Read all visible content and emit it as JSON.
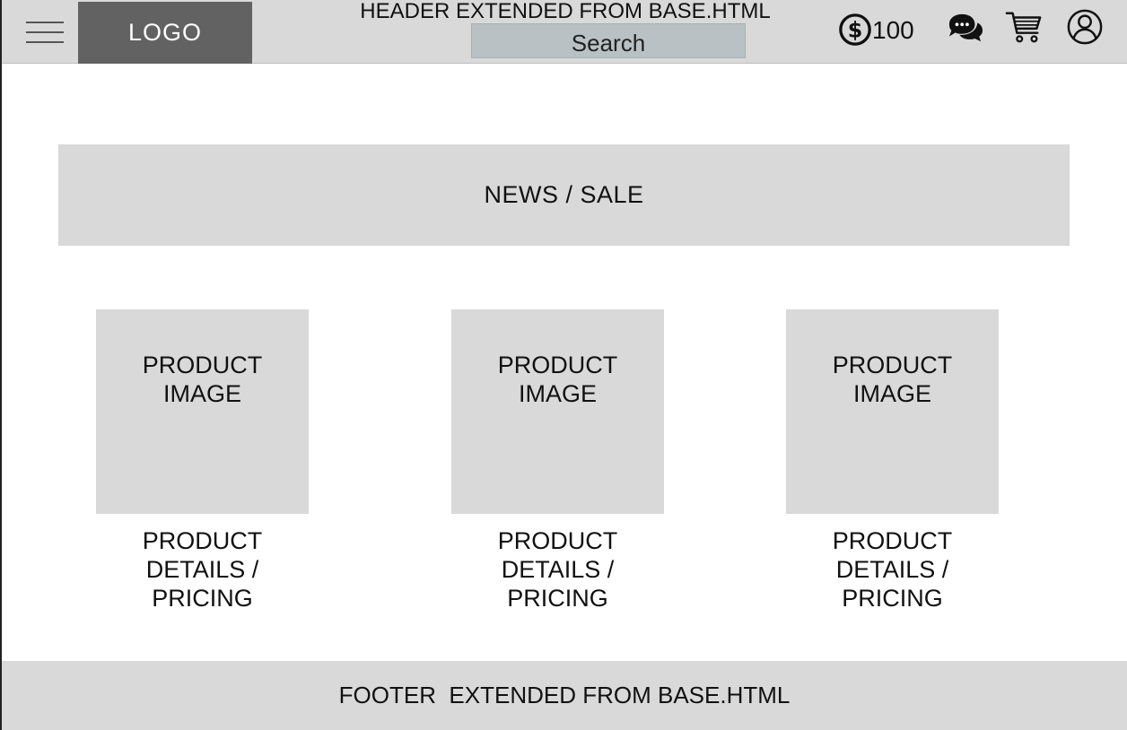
{
  "header": {
    "title": "HEADER EXTENDED FROM BASE.HTML",
    "logo": "LOGO",
    "search_label": "Search",
    "credits": "100",
    "icons": [
      "hamburger-menu-icon",
      "dollar-coin-icon",
      "chat-bubbles-icon",
      "shopping-cart-icon",
      "user-account-icon"
    ]
  },
  "banner": {
    "label": "NEWS / SALE"
  },
  "products": [
    {
      "image_label": "PRODUCT\nIMAGE",
      "details": "PRODUCT\nDETAILS /\nPRICING"
    },
    {
      "image_label": "PRODUCT\nIMAGE",
      "details": "PRODUCT\nDETAILS /\nPRICING"
    },
    {
      "image_label": "PRODUCT\nIMAGE",
      "details": "PRODUCT\nDETAILS /\nPRICING"
    }
  ],
  "footer": {
    "label": "FOOTER  EXTENDED FROM BASE.HTML"
  },
  "colors": {
    "header_bg": "#d9d9d9",
    "logo_bg": "#636262",
    "search_bg": "#b9c1c4",
    "placeholder_bg": "#d9d9d9"
  }
}
